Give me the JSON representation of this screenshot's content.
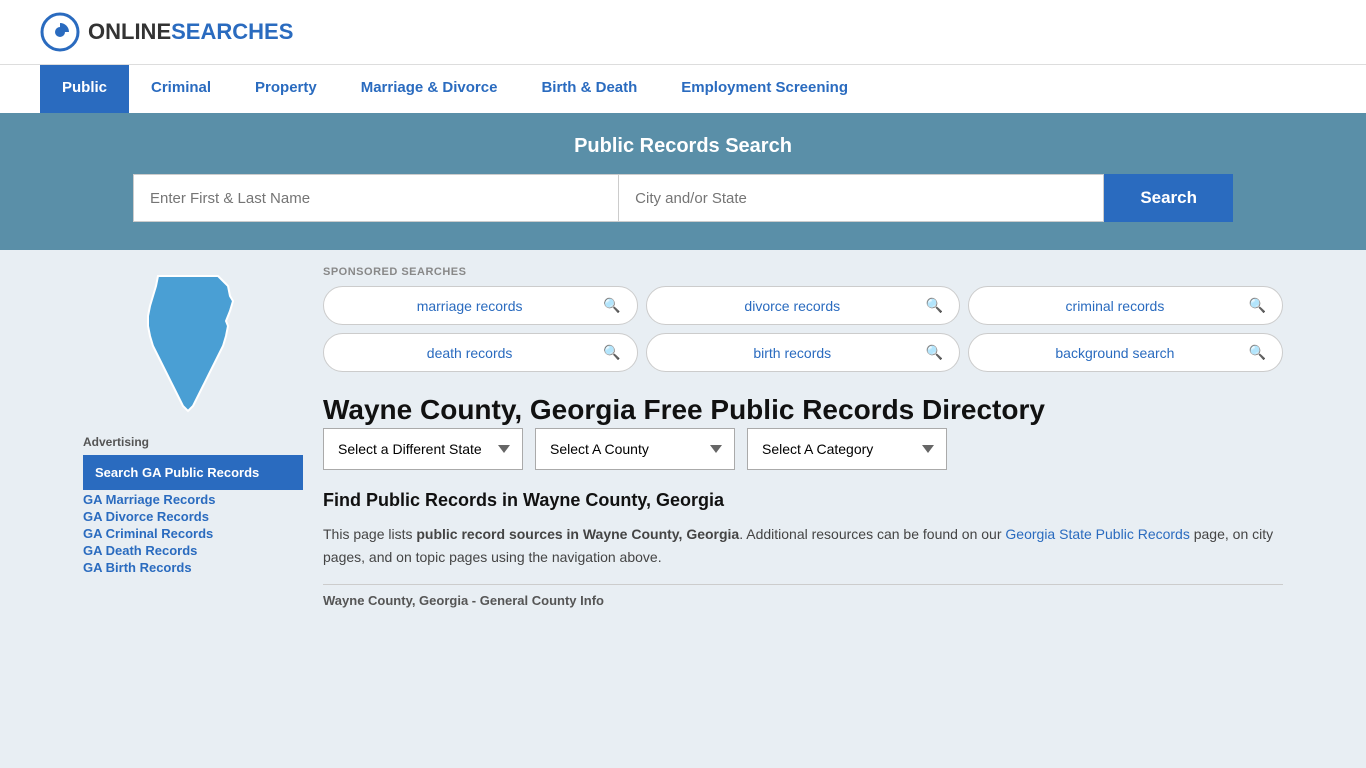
{
  "site": {
    "logo_text_plain": "ONLINE",
    "logo_text_blue": "SEARCHES"
  },
  "nav": {
    "items": [
      {
        "label": "Public",
        "active": true
      },
      {
        "label": "Criminal",
        "active": false
      },
      {
        "label": "Property",
        "active": false
      },
      {
        "label": "Marriage & Divorce",
        "active": false
      },
      {
        "label": "Birth & Death",
        "active": false
      },
      {
        "label": "Employment Screening",
        "active": false
      }
    ]
  },
  "search_banner": {
    "title": "Public Records Search",
    "name_placeholder": "Enter First & Last Name",
    "city_placeholder": "City and/or State",
    "button_label": "Search"
  },
  "sponsored": {
    "label": "SPONSORED SEARCHES",
    "items": [
      "marriage records",
      "divorce records",
      "criminal records",
      "death records",
      "birth records",
      "background search"
    ]
  },
  "page": {
    "heading": "Wayne County, Georgia Free Public Records Directory",
    "dropdowns": {
      "state_label": "Select a Different State",
      "county_label": "Select A County",
      "category_label": "Select A Category"
    },
    "find_heading": "Find Public Records in Wayne County, Georgia",
    "find_text_1": "This page lists ",
    "find_bold": "public record sources in Wayne County, Georgia",
    "find_text_2": ". Additional resources can be found on our ",
    "find_link_text": "Georgia State Public Records",
    "find_text_3": " page, on city pages, and on topic pages using the navigation above.",
    "general_info_label": "Wayne County, Georgia - General County Info"
  },
  "sidebar": {
    "ad_label": "Advertising",
    "ad_box_label": "Search GA Public Records",
    "links": [
      "GA Marriage Records",
      "GA Divorce Records",
      "GA Criminal Records",
      "GA Death Records",
      "GA Birth Records"
    ]
  },
  "colors": {
    "primary_blue": "#2a6bbf",
    "banner_bg": "#5a8fa8",
    "nav_active_bg": "#2a6bbf",
    "georgia_map": "#4a9fd4"
  }
}
